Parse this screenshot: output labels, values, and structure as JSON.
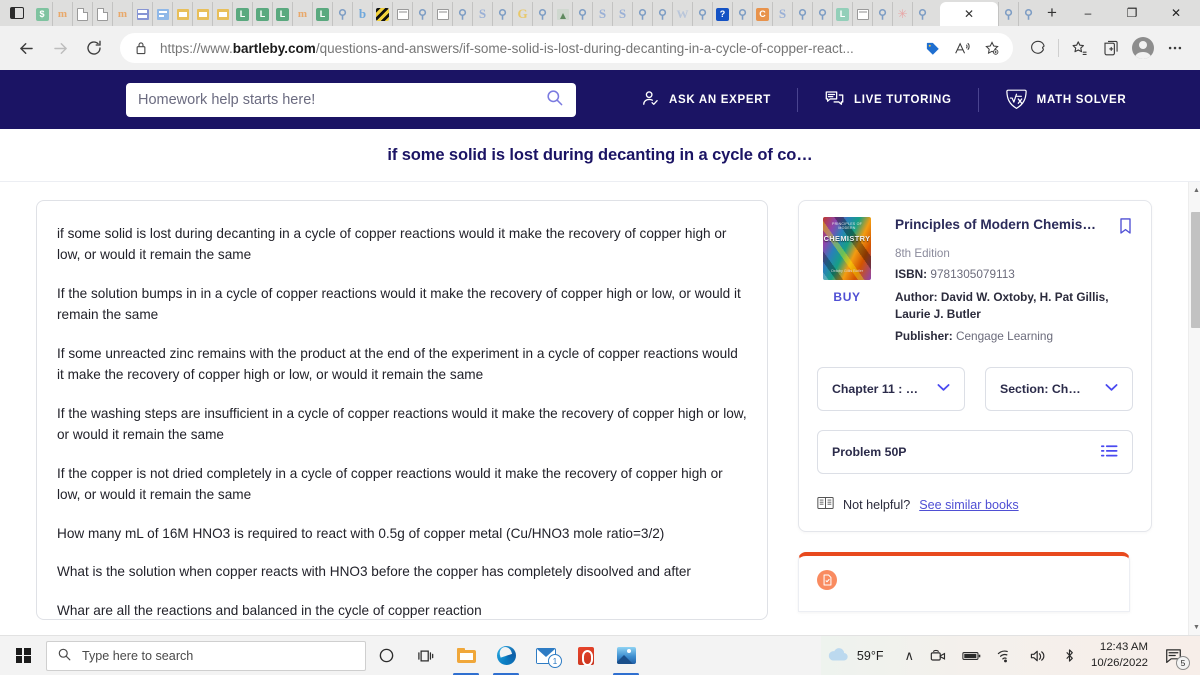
{
  "browser": {
    "window_controls": {
      "minimize": "–",
      "maximize": "❐",
      "close": "✕"
    },
    "new_tab_label": "+",
    "active_tab_close": "✕",
    "nav": {
      "back": "←",
      "forward": "→",
      "reload": "⟳"
    },
    "url_full": "https://www.bartleby.com/questions-and-answers/if-some-solid-is-lost-during-decanting-in-a-cycle-of-copper-react...",
    "url_scheme": "https://www.",
    "url_host": "bartleby.com",
    "url_path": "/questions-and-answers/if-some-solid-is-lost-during-decanting-in-a-cycle-of-copper-react...",
    "toolbar_icons": [
      "lock-icon",
      "price-tag-icon",
      "read-aloud-icon",
      "favorite-add-icon",
      "browser-essentials-icon",
      "collections-icon",
      "add-to-taskbar-icon",
      "profile-icon",
      "settings-more-icon"
    ],
    "tabs": [
      {
        "icon": "money-leaf-icon",
        "type": "color",
        "class": "fav-ltgreen",
        "glyph": "$"
      },
      {
        "icon": "moodle-icon",
        "type": "m"
      },
      {
        "icon": "document-icon",
        "type": "doc"
      },
      {
        "icon": "document-icon",
        "type": "doc"
      },
      {
        "icon": "moodle-icon",
        "type": "m"
      },
      {
        "icon": "dashboard-panel-icon",
        "type": "panel"
      },
      {
        "icon": "list-panel-icon",
        "type": "panel2"
      },
      {
        "icon": "yellow-window-icon",
        "type": "ybox"
      },
      {
        "icon": "yellow-window-icon",
        "type": "ybox"
      },
      {
        "icon": "yellow-window-icon",
        "type": "ybox"
      },
      {
        "icon": "lockdown-browser-icon",
        "type": "color",
        "class": "fav-green",
        "glyph": "L"
      },
      {
        "icon": "lockdown-browser-icon",
        "type": "color",
        "class": "fav-green",
        "glyph": "L"
      },
      {
        "icon": "lockdown-browser-icon",
        "type": "color",
        "class": "fav-green",
        "glyph": "L"
      },
      {
        "icon": "moodle-icon",
        "type": "m"
      },
      {
        "icon": "lockdown-browser-icon",
        "type": "color",
        "class": "fav-green",
        "glyph": "L"
      },
      {
        "icon": "search-tab-icon",
        "type": "mag"
      },
      {
        "icon": "bing-icon",
        "type": "b"
      },
      {
        "icon": "hazard-stripe-icon",
        "type": "stripe"
      },
      {
        "icon": "window-icon",
        "type": "win"
      },
      {
        "icon": "search-tab-icon",
        "type": "mag"
      },
      {
        "icon": "window-icon",
        "type": "win"
      },
      {
        "icon": "search-tab-icon",
        "type": "mag"
      },
      {
        "icon": "scribd-icon",
        "type": "S"
      },
      {
        "icon": "search-tab-icon",
        "type": "mag"
      },
      {
        "icon": "grammarly-icon",
        "type": "G"
      },
      {
        "icon": "search-tab-icon",
        "type": "mag"
      },
      {
        "icon": "tree-site-icon",
        "type": "tree"
      },
      {
        "icon": "search-tab-icon",
        "type": "mag"
      },
      {
        "icon": "scribd-icon",
        "type": "S"
      },
      {
        "icon": "scribd-icon",
        "type": "S"
      },
      {
        "icon": "search-tab-icon",
        "type": "mag"
      },
      {
        "icon": "search-tab-icon",
        "type": "mag"
      },
      {
        "icon": "wikipedia-icon",
        "type": "W"
      },
      {
        "icon": "search-tab-icon",
        "type": "mag"
      },
      {
        "icon": "help-question-icon",
        "type": "color",
        "class": "fav-darkblue",
        "glyph": "?"
      },
      {
        "icon": "search-tab-icon",
        "type": "mag"
      },
      {
        "icon": "chegg-icon",
        "type": "color",
        "class": "fav-orange",
        "glyph": "C"
      },
      {
        "icon": "scribd-icon",
        "type": "S"
      },
      {
        "icon": "search-tab-icon",
        "type": "mag"
      },
      {
        "icon": "search-tab-icon",
        "type": "mag"
      },
      {
        "icon": "lockdown-browser-icon",
        "type": "color",
        "class": "fav-teal",
        "glyph": "L"
      },
      {
        "icon": "window-icon",
        "type": "win"
      },
      {
        "icon": "search-tab-icon",
        "type": "mag"
      },
      {
        "icon": "sparkle-icon",
        "type": "sprinkle"
      },
      {
        "icon": "search-tab-icon",
        "type": "mag"
      }
    ],
    "tabs_after_active": [
      {
        "icon": "search-tab-icon",
        "type": "mag"
      },
      {
        "icon": "search-tab-icon",
        "type": "mag"
      }
    ]
  },
  "site": {
    "search_placeholder": "Homework help starts here!",
    "search_value": "",
    "search_icon": "search-icon",
    "nav_items": [
      {
        "label": "ASK AN EXPERT",
        "icon": "expert-person-icon"
      },
      {
        "label": "LIVE TUTORING",
        "icon": "chat-bubbles-icon"
      },
      {
        "label": "MATH SOLVER",
        "icon": "sqrt-x-icon"
      }
    ],
    "page_title": "if some solid is lost during decanting in a cycle of co…",
    "brand_navy": "#1b1464",
    "accent_indigo": "#4f4fd4"
  },
  "question_card": {
    "paragraphs": [
      "if some solid is lost during decanting in a cycle of copper reactions would it make the recovery of copper high or low, or would it remain the same",
      "If the solution bumps in  in a cycle of copper reactions would it make the recovery of copper high or low, or would it remain the same",
      "If some unreacted zinc remains with the product at the end of the experiment  in a cycle of copper reactions would it make the recovery of copper high or low, or would it remain the same",
      "If the washing steps are insufficient  in a cycle of copper reactions would it make the recovery of copper high or low, or would it remain the same",
      "If the copper is not dried completely  in a cycle of copper reactions would it make the recovery of copper high or low, or would it remain the same",
      "How many mL of 16M HNO3 is required to react with 0.5g of copper metal (Cu/HNO3 mole ratio=3/2)",
      "What is the solution when copper reacts with HNO3 before the copper has completely disoolved and after",
      "Whar are all the reactions and balanced in the cycle of copper reaction"
    ]
  },
  "book_card": {
    "thumbnail_top": "PRINCIPLES OF MODERN",
    "thumbnail_title": "CHEMISTRY",
    "thumbnail_bottom": "Oxtoby  Gillis  Butler",
    "buy_label": "BUY",
    "title": "Principles of Modern Chemis…",
    "bookmark_icon": "bookmark-icon",
    "edition": "8th Edition",
    "isbn_label": "ISBN:",
    "isbn_value": "9781305079113",
    "author_label": "Author:",
    "author_value": "David W. Oxtoby, H. Pat Gillis, Laurie J. Butler",
    "publisher_label": "Publisher:",
    "publisher_value": "Cengage Learning",
    "chapter_select": "Chapter 11 : …",
    "section_select": "Section: Ch…",
    "problem_value": "Problem 50P",
    "problem_list_icon": "list-icon",
    "not_helpful_icon": "open-book-icon",
    "not_helpful_text": "Not helpful?",
    "similar_books_link": "See similar books"
  },
  "orange_card": {
    "icon": "document-check-icon"
  },
  "scrollbar": {
    "up_arrow": "▲",
    "down_arrow": "▼"
  },
  "taskbar": {
    "start_icon": "windows-start-icon",
    "search_icon": "search-icon",
    "search_placeholder": "Type here to search",
    "cortana_icon": "cortana-circle-icon",
    "taskview_icon": "task-view-icon",
    "apps": [
      {
        "name": "file-explorer-icon"
      },
      {
        "name": "microsoft-edge-icon"
      },
      {
        "name": "mail-icon",
        "badge": "1"
      },
      {
        "name": "office-icon"
      },
      {
        "name": "photos-icon"
      }
    ],
    "weather_icon": "cloud-icon",
    "weather_temp": "59°F",
    "tray_expand": "∧",
    "tray_icons": [
      "meet-now-icon",
      "battery-icon",
      "wifi-icon",
      "volume-icon",
      "bluetooth-icon"
    ],
    "time": "12:43 AM",
    "date": "10/26/2022",
    "notification_icon": "notifications-icon",
    "notification_count": "5"
  }
}
